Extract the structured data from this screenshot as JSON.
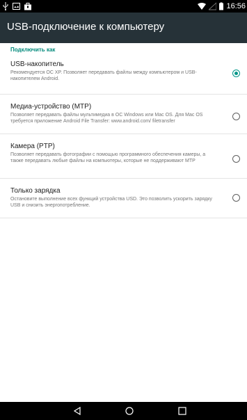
{
  "status_bar": {
    "time": "16:56",
    "icons": [
      "usb-icon",
      "image-icon",
      "shopping-bag-icon",
      "wifi-icon",
      "no-signal-icon",
      "battery-icon"
    ]
  },
  "action_bar": {
    "title": "USB-подключение к компьютеру"
  },
  "section": {
    "header": "Подключить как"
  },
  "options": [
    {
      "title": "USB-накопитель",
      "summary": "Рекомендуется ОС XP. Позволяет передавать файлы между компьютером и USB-накопителем Android.",
      "checked": true
    },
    {
      "title": "Медиа-устройство (MTP)",
      "summary": "Позволяет передавать файлы мультимедиа в ОС Windows или Mac OS. Для Mac OS требуется приложение Android File Transfer: www.android.com/ filetransfer",
      "checked": false
    },
    {
      "title": "Камера (PTP)",
      "summary": "Позволяет передавать фотографии с помощью программного обеспечения камеры, а также передавать любые файлы на компьютеры, которые не поддерживают MTP",
      "checked": false
    },
    {
      "title": "Только зарядка",
      "summary": "Остановите выполнение всех функций устройства USD. Это позволить ускорить зарядку USB и снизить энергопотребление.",
      "checked": false
    }
  ],
  "colors": {
    "accent": "#009688",
    "action_bar": "#263238",
    "section_header": "#00897b"
  },
  "nav_bar": {
    "icons": [
      "back-icon",
      "home-icon",
      "recent-apps-icon"
    ]
  }
}
